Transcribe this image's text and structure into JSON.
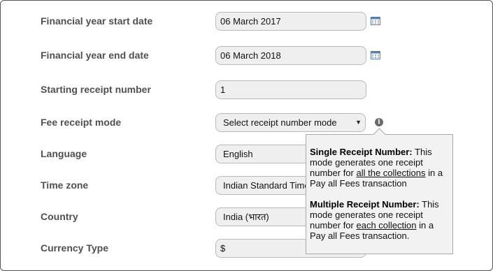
{
  "form": {
    "fy_start": {
      "label": "Financial year start date",
      "value": "06 March 2017"
    },
    "fy_end": {
      "label": "Financial year end date",
      "value": "06 March 2018"
    },
    "receipt_start": {
      "label": "Starting receipt number",
      "value": "1"
    },
    "receipt_mode": {
      "label": "Fee receipt mode",
      "value": "Select receipt number mode"
    },
    "language": {
      "label": "Language",
      "value": "English"
    },
    "timezone": {
      "label": "Time zone",
      "value": "Indian Standard Time"
    },
    "country": {
      "label": "Country",
      "value": "India (भारत)"
    },
    "currency": {
      "label": "Currency Type",
      "value": "$"
    }
  },
  "tooltip": {
    "single_title": "Single Receipt Number:",
    "single_pre": " This mode generates one receipt number for ",
    "single_link": "all the collections",
    "single_post": " in a Pay all Fees transaction",
    "multi_title": "Multiple Receipt Number:",
    "multi_pre": " This mode generates one receipt number for ",
    "multi_link": "each collection",
    "multi_post": " in a Pay all Fees transaction."
  },
  "icons": {
    "calendar": "calendar-icon",
    "info": "info-icon",
    "dropdown": "chevron-down-icon"
  }
}
